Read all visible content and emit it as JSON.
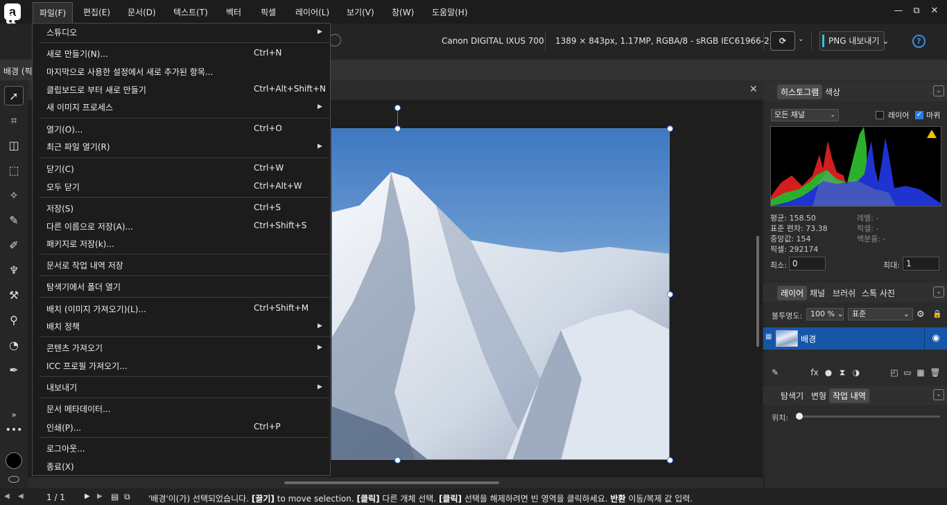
{
  "menubar": {
    "items": [
      "파일(F)",
      "편집(E)",
      "문서(D)",
      "텍스트(T)",
      "벡터",
      "픽셀",
      "레이어(L)",
      "보기(V)",
      "창(W)",
      "도움말(H)"
    ]
  },
  "window": {
    "minimize": "—",
    "restore": "⧉",
    "close": "✕"
  },
  "toolbar": {
    "camera": "Canon DIGITAL IXUS 700",
    "image_info": "1389 × 843px, 1.17MP, RGBA/8 - sRGB IEC61966-2.1",
    "export_label": "PNG 내보내기",
    "export_accent": "#39c0e8"
  },
  "context": {
    "label": "배경 (픽"
  },
  "file_menu": [
    {
      "label": "스튜디오",
      "shortcut": "",
      "submenu": true
    },
    {
      "label": "새로 만들기(N)...",
      "shortcut": "Ctrl+N",
      "submenu": false
    },
    {
      "label": "마지막으로 사용한 설정에서 새로 추가된 항목...",
      "shortcut": "",
      "submenu": false
    },
    {
      "label": "클립보드로 부터 새로 만들기",
      "shortcut": "Ctrl+Alt+Shift+N",
      "submenu": false
    },
    {
      "label": "새 이미지 프로세스",
      "shortcut": "",
      "submenu": true
    },
    {
      "label": "열기(O)...",
      "shortcut": "Ctrl+O",
      "submenu": false
    },
    {
      "label": "최근 파일 열기(R)",
      "shortcut": "",
      "submenu": true
    },
    {
      "label": "닫기(C)",
      "shortcut": "Ctrl+W",
      "submenu": false
    },
    {
      "label": "모두 닫기",
      "shortcut": "Ctrl+Alt+W",
      "submenu": false
    },
    {
      "label": "저장(S)",
      "shortcut": "Ctrl+S",
      "submenu": false
    },
    {
      "label": "다른 이름으로 저장(A)...",
      "shortcut": "Ctrl+Shift+S",
      "submenu": false
    },
    {
      "label": "패키지로 저장(k)...",
      "shortcut": "",
      "submenu": false
    },
    {
      "label": "문서로 작업 내역 저장",
      "shortcut": "",
      "submenu": false
    },
    {
      "label": "탐색기에서 폴더 열기",
      "shortcut": "",
      "submenu": false
    },
    {
      "label": "배치 (이미지 가져오기)(L)...",
      "shortcut": "Ctrl+Shift+M",
      "submenu": false
    },
    {
      "label": "배치 정책",
      "shortcut": "",
      "submenu": true
    },
    {
      "label": "콘텐츠 가져오기",
      "shortcut": "",
      "submenu": true
    },
    {
      "label": "ICC 프로필 가져오기...",
      "shortcut": "",
      "submenu": false
    },
    {
      "label": "내보내기",
      "shortcut": "",
      "submenu": true
    },
    {
      "label": "문서 메타데이터...",
      "shortcut": "",
      "submenu": false
    },
    {
      "label": "인쇄(P)...",
      "shortcut": "Ctrl+P",
      "submenu": false
    },
    {
      "label": "로그아웃...",
      "shortcut": "",
      "submenu": false
    },
    {
      "label": "종료(X)",
      "shortcut": "",
      "submenu": false
    }
  ],
  "histogram": {
    "tabs": [
      "히스토그램",
      "색상"
    ],
    "channel": "모든 채널",
    "layer_label": "레이어",
    "marquee_label": "마퀴",
    "marquee_checked": true,
    "mean": "평균: 158.50",
    "stddev": "표준 편차: 73.38",
    "median": "중앙값: 154",
    "pixels": "픽셀: 292174",
    "level": "레벨: -",
    "px": "픽셀: -",
    "percentile": "백분율: -",
    "min_label": "최소:",
    "min_value": "0",
    "max_label": "최대:",
    "max_value": "1",
    "warning_color": "#f2c200"
  },
  "layers": {
    "tabs": [
      "레이어",
      "채널",
      "브러쉬",
      "스톡 사진"
    ],
    "opacity_label": "불투명도:",
    "opacity_value": "100 %",
    "blend_mode": "표준",
    "layer_name": "배경",
    "selected_color": "#1656a6"
  },
  "history": {
    "tabs": [
      "탐색기",
      "변형",
      "작업 내역"
    ],
    "position_label": "위치:"
  },
  "status": {
    "page": "1 / 1",
    "msg_1": "'배경'이(가) 선택되었습니다.",
    "b1": "[끌기]",
    "msg_2": "to move selection.",
    "b2": "[클릭]",
    "msg_3": "다른 개체 선택.",
    "b3": "[클릭]",
    "msg_4": "선택을 해제하려면 빈 영역을 클릭하세요.",
    "b4": "반환",
    "msg_5": "이동/복제 값 입력."
  }
}
